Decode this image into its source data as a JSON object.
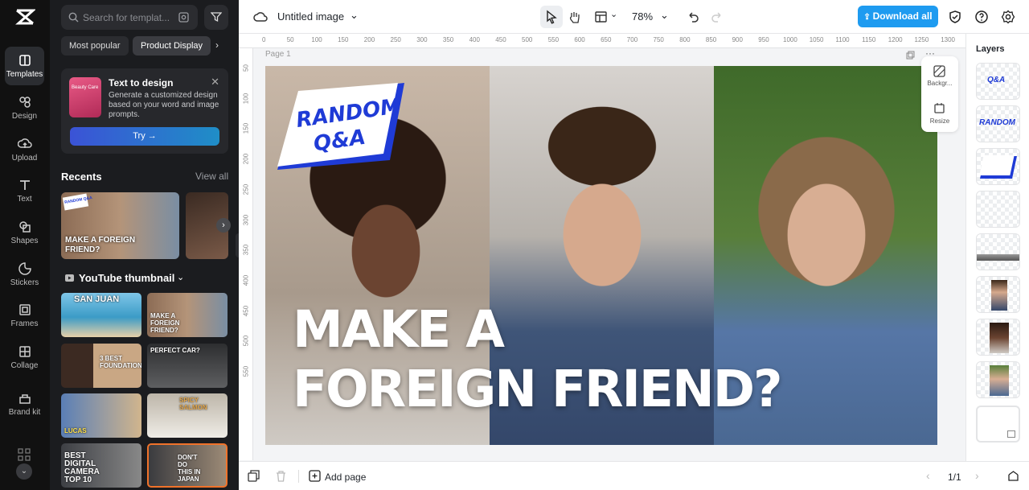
{
  "sidebar": {
    "items": [
      {
        "label": "Templates",
        "icon": "templates-icon"
      },
      {
        "label": "Design",
        "icon": "design-icon"
      },
      {
        "label": "Upload",
        "icon": "upload-icon"
      },
      {
        "label": "Text",
        "icon": "text-icon"
      },
      {
        "label": "Shapes",
        "icon": "shapes-icon"
      },
      {
        "label": "Stickers",
        "icon": "stickers-icon"
      },
      {
        "label": "Frames",
        "icon": "frames-icon"
      },
      {
        "label": "Collage",
        "icon": "collage-icon"
      },
      {
        "label": "Brand kit",
        "icon": "brand-kit-icon"
      }
    ]
  },
  "panel": {
    "search_placeholder": "Search for templat...",
    "chips": [
      "Most popular",
      "Product Display"
    ],
    "promo": {
      "thumb_text": "Beauty Care",
      "title": "Text to design",
      "description": "Generate a customized design based on your word and image prompts.",
      "button": "Try →"
    },
    "recents_title": "Recents",
    "view_all": "View all",
    "recent_caption_top": "RANDOM Q&A",
    "recent_caption": "MAKE A FOREIGN FRIEND?",
    "youtube_title": "YouTube thumbnail",
    "templates": [
      {
        "caption": "SAN JUAN"
      },
      {
        "caption": "MAKE A FOREIGN FRIEND?"
      },
      {
        "caption": "3 BEST FOUNDATIONS"
      },
      {
        "caption": "PERFECT CAR?"
      },
      {
        "caption": "LUCAS"
      },
      {
        "caption": "SPICY SALMON"
      },
      {
        "caption": "BEST DIGITAL CAMERA TOP 10"
      },
      {
        "caption": "DON'T DO THIS IN JAPAN"
      }
    ]
  },
  "topbar": {
    "title": "Untitled image",
    "zoom": "78%",
    "download": "Download all"
  },
  "ruler": [
    "0",
    "50",
    "100",
    "150",
    "200",
    "250",
    "300",
    "350",
    "400",
    "450",
    "500",
    "550",
    "600",
    "650",
    "700",
    "750",
    "800",
    "850",
    "900",
    "950",
    "1000",
    "1050",
    "1100",
    "1150",
    "1200",
    "1250",
    "1300"
  ],
  "vruler": [
    "50",
    "100",
    "150",
    "200",
    "250",
    "300",
    "350",
    "400",
    "450",
    "500",
    "550"
  ],
  "canvas": {
    "page_label": "Page 1",
    "badge_line1": "RANDOM",
    "badge_line2": "Q&A",
    "headline_line1": "MAKE A",
    "headline_line2": "FOREIGN FRIEND?",
    "side_tools": [
      "Backgr...",
      "Resize"
    ]
  },
  "layers": {
    "title": "Layers",
    "items": [
      "Q&A",
      "RANDOM",
      "badge-shape",
      "headline-text",
      "gradient-bar",
      "photo-man",
      "photo-woman-left",
      "photo-woman-right",
      "background"
    ]
  },
  "bottombar": {
    "add_page": "Add page",
    "page_count": "1/1"
  },
  "colors": {
    "accent": "#1e9bf0",
    "badge": "#1f3bd6",
    "rail_bg": "#111111",
    "panel_bg": "#1b1c1f"
  }
}
